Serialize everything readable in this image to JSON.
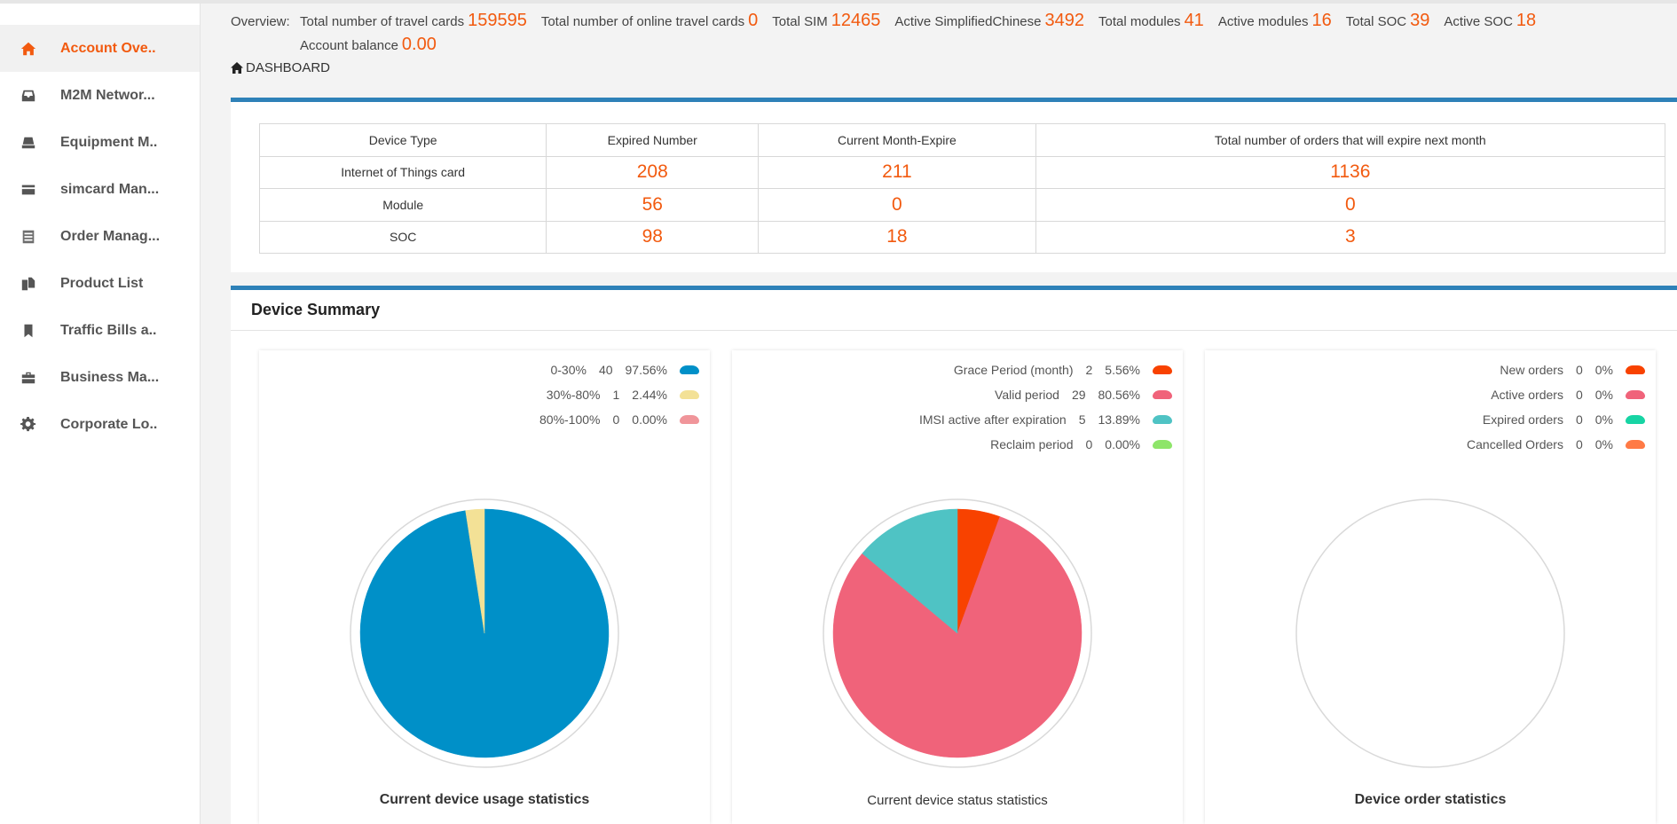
{
  "sidebar": {
    "items": [
      {
        "label": "Account Ove..",
        "icon": "home-icon",
        "active": true
      },
      {
        "label": "M2M Networ...",
        "icon": "inbox-icon"
      },
      {
        "label": "Equipment M..",
        "icon": "hdd-icon"
      },
      {
        "label": "simcard Man...",
        "icon": "credit-card-icon"
      },
      {
        "label": "Order Manag...",
        "icon": "list-alt-icon"
      },
      {
        "label": "Product List",
        "icon": "copy-icon"
      },
      {
        "label": "Traffic Bills a..",
        "icon": "bookmark-icon"
      },
      {
        "label": "Business Ma...",
        "icon": "briefcase-icon"
      },
      {
        "label": "Corporate Lo..",
        "icon": "gear-icon"
      }
    ]
  },
  "overview": {
    "label": "Overview:",
    "items": [
      {
        "label": "Total number of travel cards",
        "value": "159595"
      },
      {
        "label": "Total number of online travel cards",
        "value": "0"
      },
      {
        "label": "Total SIM",
        "value": "12465"
      },
      {
        "label": "Active SimplifiedChinese",
        "value": "3492"
      },
      {
        "label": "Total modules",
        "value": "41"
      },
      {
        "label": "Active modules",
        "value": "16"
      },
      {
        "label": "Total SOC",
        "value": "39"
      },
      {
        "label": "Active SOC",
        "value": "18"
      }
    ],
    "balance": {
      "label": "Account balance",
      "value": "0.00"
    }
  },
  "breadcrumb": {
    "label": "DASHBOARD"
  },
  "expiry_table": {
    "headers": [
      "Device Type",
      "Expired Number",
      "Current Month-Expire",
      "Total number of orders that will expire next month"
    ],
    "rows": [
      [
        "Internet of Things card",
        "208",
        "211",
        "1136"
      ],
      [
        "Module",
        "56",
        "0",
        "0"
      ],
      [
        "SOC",
        "98",
        "18",
        "3"
      ]
    ]
  },
  "summary": {
    "title": "Device Summary"
  },
  "colors": {
    "accent": "#f25a0f",
    "panel_bar": "#2e81b8"
  },
  "chart_data": [
    {
      "type": "pie",
      "title": "Current device usage statistics",
      "categories": [
        "0-30%",
        "30%-80%",
        "80%-100%"
      ],
      "values": [
        40,
        1,
        0
      ],
      "percents": [
        "97.56%",
        "2.44%",
        "0.00%"
      ],
      "colors": [
        "#0090c8",
        "#f3e196",
        "#f0959a"
      ],
      "legend": "top-right"
    },
    {
      "type": "pie",
      "title": "Current device status statistics",
      "categories": [
        "Grace Period (month)",
        "Valid period",
        "IMSI active after expiration",
        "Reclaim period"
      ],
      "values": [
        2,
        29,
        5,
        0
      ],
      "percents": [
        "5.56%",
        "80.56%",
        "13.89%",
        "0.00%"
      ],
      "colors": [
        "#f84200",
        "#f0637a",
        "#4fc3c4",
        "#8ee56a"
      ],
      "legend": "top-right"
    },
    {
      "type": "pie",
      "title": "Device order statistics",
      "categories": [
        "New orders",
        "Active orders",
        "Expired orders",
        "Cancelled Orders"
      ],
      "values": [
        0,
        0,
        0,
        0
      ],
      "percents": [
        "0%",
        "0%",
        "0%",
        "0%"
      ],
      "colors": [
        "#f84200",
        "#f0637a",
        "#17d4a4",
        "#ff7a45"
      ],
      "legend": "top-right"
    }
  ]
}
